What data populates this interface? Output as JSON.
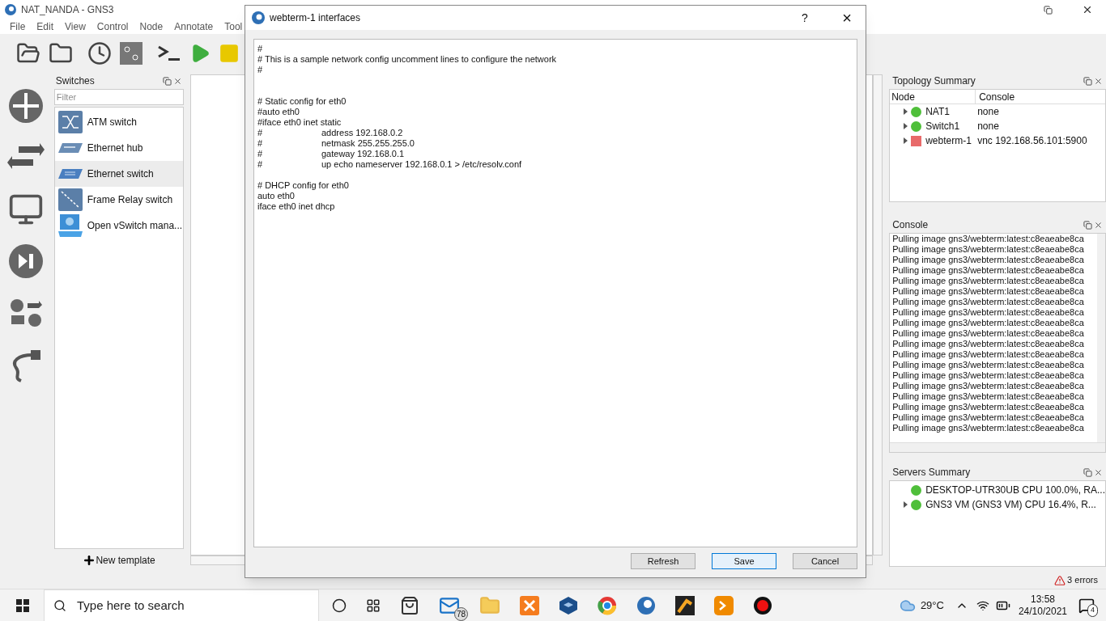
{
  "window": {
    "title": "NAT_NANDA - GNS3"
  },
  "menu": [
    "File",
    "Edit",
    "View",
    "Control",
    "Node",
    "Annotate",
    "Tool"
  ],
  "switches_panel": {
    "title": "Switches",
    "filter": {
      "placeholder": "Filter"
    },
    "items": [
      {
        "label": "ATM switch",
        "kind": "atm",
        "selected": false
      },
      {
        "label": "Ethernet hub",
        "kind": "hub",
        "selected": false
      },
      {
        "label": "Ethernet switch",
        "kind": "switch",
        "selected": true
      },
      {
        "label": "Frame Relay switch",
        "kind": "framerelay",
        "selected": false
      },
      {
        "label": "Open vSwitch mana...",
        "kind": "ovs",
        "selected": false
      }
    ],
    "new_template": "New template"
  },
  "topology": {
    "title": "Topology Summary",
    "columns": [
      "Node",
      "Console"
    ],
    "rows": [
      {
        "node": "NAT1",
        "console": "none",
        "kind": "circle",
        "color": "#4fbf3a",
        "expandable": true
      },
      {
        "node": "Switch1",
        "console": "none",
        "kind": "circle",
        "color": "#4fbf3a",
        "expandable": true
      },
      {
        "node": "webterm-1",
        "console": "vnc 192.168.56.101:5900",
        "kind": "square",
        "color": "#e86a6a",
        "expandable": true
      }
    ]
  },
  "console": {
    "title": "Console",
    "lines": [
      "Pulling image gns3/webterm:latest:c8eaeabe8ca",
      "Pulling image gns3/webterm:latest:c8eaeabe8ca",
      "Pulling image gns3/webterm:latest:c8eaeabe8ca",
      "Pulling image gns3/webterm:latest:c8eaeabe8ca",
      "Pulling image gns3/webterm:latest:c8eaeabe8ca",
      "Pulling image gns3/webterm:latest:c8eaeabe8ca",
      "Pulling image gns3/webterm:latest:c8eaeabe8ca",
      "Pulling image gns3/webterm:latest:c8eaeabe8ca",
      "Pulling image gns3/webterm:latest:c8eaeabe8ca",
      "Pulling image gns3/webterm:latest:c8eaeabe8ca",
      "Pulling image gns3/webterm:latest:c8eaeabe8ca",
      "Pulling image gns3/webterm:latest:c8eaeabe8ca",
      "Pulling image gns3/webterm:latest:c8eaeabe8ca",
      "Pulling image gns3/webterm:latest:c8eaeabe8ca",
      "Pulling image gns3/webterm:latest:c8eaeabe8ca",
      "Pulling image gns3/webterm:latest:c8eaeabe8ca",
      "Pulling image gns3/webterm:latest:c8eaeabe8ca",
      "Pulling image gns3/webterm:latest:c8eaeabe8ca",
      "Pulling image gns3/webterm:latest:c8eaeabe8ca"
    ]
  },
  "servers": {
    "title": "Servers Summary",
    "rows": [
      {
        "label": "DESKTOP-UTR30UB CPU 100.0%, RA...",
        "kind": "circle",
        "color": "#4fbf3a",
        "expandable": false
      },
      {
        "label": "GNS3 VM (GNS3 VM) CPU 16.4%, R...",
        "kind": "circle",
        "color": "#4fbf3a",
        "expandable": true
      }
    ]
  },
  "status_bar": {
    "errors": "3 errors"
  },
  "dialog": {
    "title": "webterm-1 interfaces",
    "help": "?",
    "close": "×",
    "config": "#\n# This is a sample network config uncomment lines to configure the network\n#\n\n\n# Static config for eth0\n#auto eth0\n#iface eth0 inet static\n#\taddress 192.168.0.2\n#\tnetmask 255.255.255.0\n#\tgateway 192.168.0.1\n#\tup echo nameserver 192.168.0.1 > /etc/resolv.conf\n\n# DHCP config for eth0\nauto eth0\niface eth0 inet dhcp",
    "buttons": [
      {
        "label": "Refresh",
        "selected": false
      },
      {
        "label": "Save",
        "selected": true
      },
      {
        "label": "Cancel",
        "selected": false
      }
    ]
  },
  "taskbar": {
    "search": {
      "placeholder": "Type here to search"
    },
    "mail_badge": "78",
    "temperature": "29°C",
    "time": "13:58",
    "date": "24/10/2021",
    "notifications": "4"
  }
}
